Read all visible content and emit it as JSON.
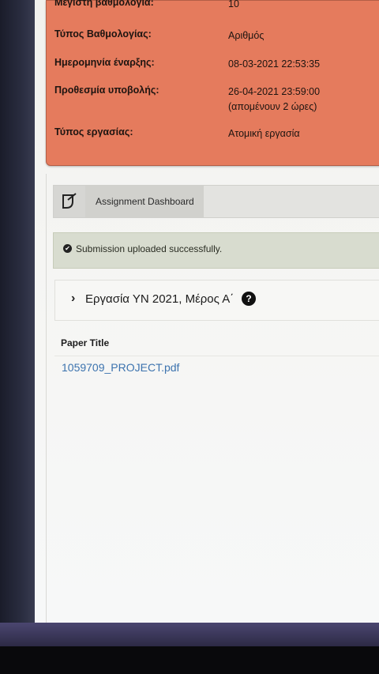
{
  "info": {
    "max_grade_label": "Μέγιστη βαθμολογία:",
    "max_grade_value": "10",
    "grade_type_label": "Τύπος Βαθμολογίας:",
    "grade_type_value": "Αριθμός",
    "start_date_label": "Ημερομηνία έναρξης:",
    "start_date_value": "08-03-2021 22:53:35",
    "deadline_label": "Προθεσμία υποβολής:",
    "deadline_value": "26-04-2021 23:59:00",
    "deadline_remaining": "(απομένουν 2 ώρες)",
    "work_type_label": "Τύπος εργασίας:",
    "work_type_value": "Ατομική εργασία"
  },
  "dashboard": {
    "tab_label": "Assignment Dashboard"
  },
  "alert": {
    "message": "Submission uploaded successfully."
  },
  "assignment": {
    "title": "Εργασία ΥΝ 2021, Μέρος Α΄",
    "help_symbol": "?"
  },
  "paper": {
    "header": "Paper Title",
    "file_name": "1059709_PROJECT.pdf"
  },
  "colors": {
    "info_card": "#e57b5d",
    "alert_bg": "#d8dccf",
    "link": "#3c73ae"
  }
}
